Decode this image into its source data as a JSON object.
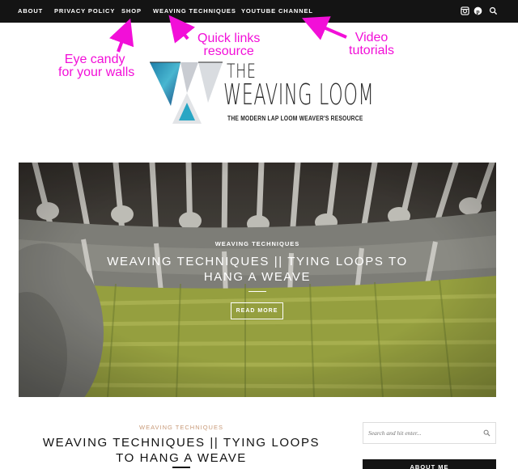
{
  "nav": {
    "items": [
      {
        "label": "ABOUT"
      },
      {
        "label": "PRIVACY POLICY"
      },
      {
        "label": "SHOP"
      },
      {
        "label": "WEAVING TECHNIQUES"
      },
      {
        "label": "YOUTUBE CHANNEL"
      }
    ],
    "icons": [
      "instagram-icon",
      "pinterest-icon",
      "search-icon"
    ]
  },
  "annotations": {
    "shop": [
      "Eye candy",
      "for your walls"
    ],
    "weaving": [
      "Quick links",
      "resource"
    ],
    "youtube": [
      "Video",
      "tutorials"
    ],
    "color": "#f20fd8"
  },
  "logo": {
    "the": "THE",
    "title": "WEAVING LOOM",
    "tagline": "THE MODERN LAP LOOM WEAVER'S RESOURCE"
  },
  "hero": {
    "category": "WEAVING TECHNIQUES",
    "title": "WEAVING TECHNIQUES || TYING LOOPS TO HANG A WEAVE",
    "button": "READ MORE"
  },
  "post": {
    "category": "WEAVING TECHNIQUES",
    "title": "WEAVING TECHNIQUES || TYING LOOPS TO HANG A WEAVE"
  },
  "sidebar": {
    "search_placeholder": "Search and hit enter...",
    "about_heading": "ABOUT ME"
  },
  "colors": {
    "nav_bg": "#141414",
    "category_accent": "#c89a78",
    "yarn_green": "#b9c24f",
    "yarn_grey": "#9a9a94"
  }
}
